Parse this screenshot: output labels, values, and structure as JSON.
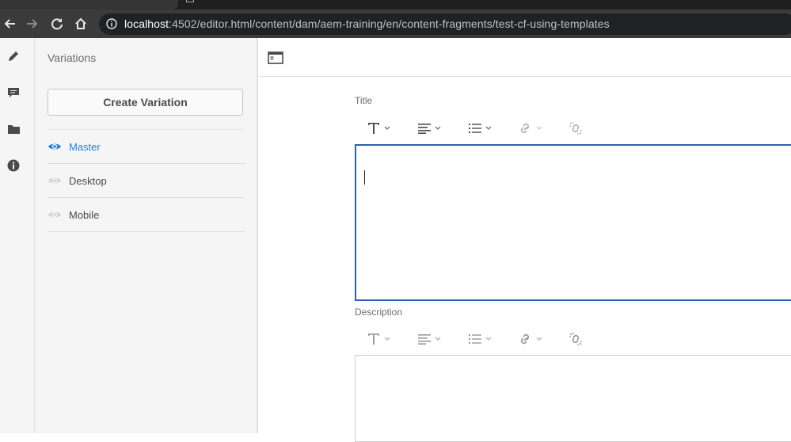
{
  "browser": {
    "url_host": "localhost",
    "url_rest": ":4502/editor.html/content/dam/aem-training/en/content-fragments/test-cf-using-templates"
  },
  "colors": {
    "accent": "#2680eb",
    "focus_border": "#2d5fb3",
    "rail_bg": "#f5f5f5"
  },
  "rail": {
    "items": [
      {
        "icon": "pencil-icon"
      },
      {
        "icon": "comment-icon"
      },
      {
        "icon": "folder-icon"
      },
      {
        "icon": "info-icon"
      }
    ]
  },
  "variations": {
    "title": "Variations",
    "create_label": "Create Variation",
    "items": [
      {
        "label": "Master",
        "active": true
      },
      {
        "label": "Desktop",
        "active": false
      },
      {
        "label": "Mobile",
        "active": false
      }
    ]
  },
  "editor": {
    "fields": [
      {
        "label": "Title",
        "focused": true
      },
      {
        "label": "Description",
        "focused": false
      }
    ],
    "toolbar_icons": [
      "text-format-icon",
      "align-icon",
      "list-icon",
      "link-icon",
      "unlink-icon"
    ]
  }
}
